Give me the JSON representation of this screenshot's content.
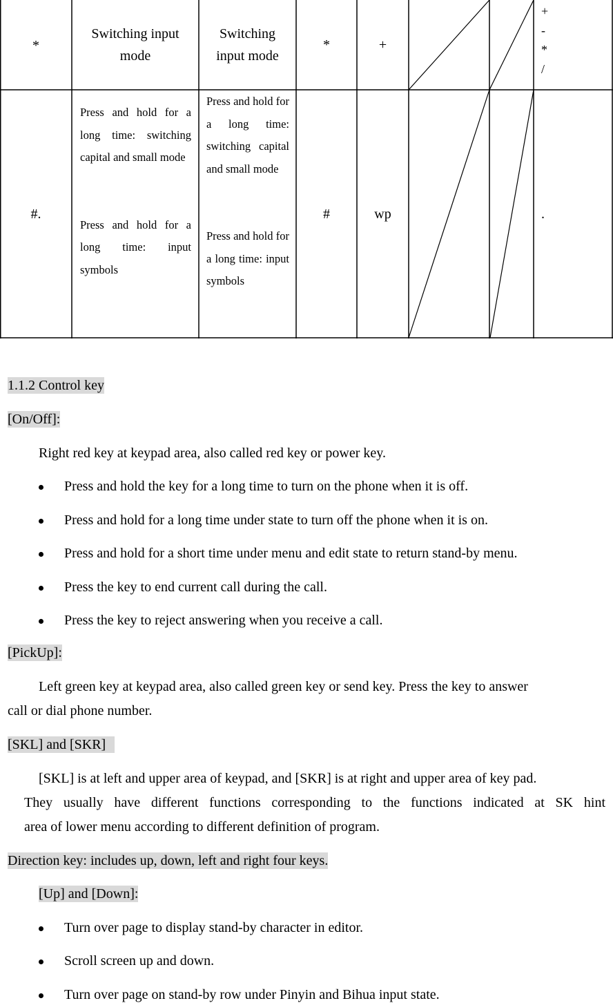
{
  "table": {
    "rows": [
      {
        "key": "*",
        "col2": [
          "Switching input",
          "mode"
        ],
        "col3": [
          "Switching",
          "input mode"
        ],
        "col4": "*",
        "col5": "+",
        "col8": [
          "+",
          "-",
          "*",
          "/"
        ]
      },
      {
        "key": "#.",
        "col2_a": "Press and hold for a long time: switching capital and small mode",
        "col2_b": "Press and hold for a long time: input symbols",
        "col3_a": "Press and hold for a long time: switching capital and small mode",
        "col3_b": "Press and hold for a long time: input symbols",
        "col4": "#",
        "col5": "wp",
        "col8": "."
      }
    ]
  },
  "section": {
    "heading": "1.1.2 Control key",
    "onoff": {
      "label": "[On/Off]:",
      "desc": "Right red key at keypad area, also called red key or power key.",
      "bullets": [
        "Press and hold the key for a long time to turn on the phone when it is off.",
        "Press and hold for a long time under state to turn off the phone when it is on.",
        "Press and hold for a short time under menu and edit state to return stand-by menu.",
        "Press the key to end current call during the call.",
        "Press the key to reject answering when you receive a call."
      ]
    },
    "pickup": {
      "label": "[PickUp]:",
      "desc_line1": "Left green key at keypad area, also called green key or send key. Press the key to answer",
      "desc_line2": "call or dial phone number."
    },
    "skl_skr": {
      "label": "[SKL] and [SKR]",
      "desc_line1": "[SKL] is at left and upper area of keypad, and [SKR] is at right and upper area of key pad.",
      "desc_line2": "They usually have different functions corresponding to the functions indicated at SK hint",
      "desc_line3": "area of lower menu according to different definition of program."
    },
    "direction": {
      "label": "Direction key: includes up, down, left and right four keys.",
      "updown_label": "[Up] and [Down]:",
      "bullets": [
        "Turn over page to display stand-by character in editor.",
        "Scroll screen up and down.",
        "Turn over page on stand-by row under Pinyin and Bihua input state."
      ]
    }
  }
}
